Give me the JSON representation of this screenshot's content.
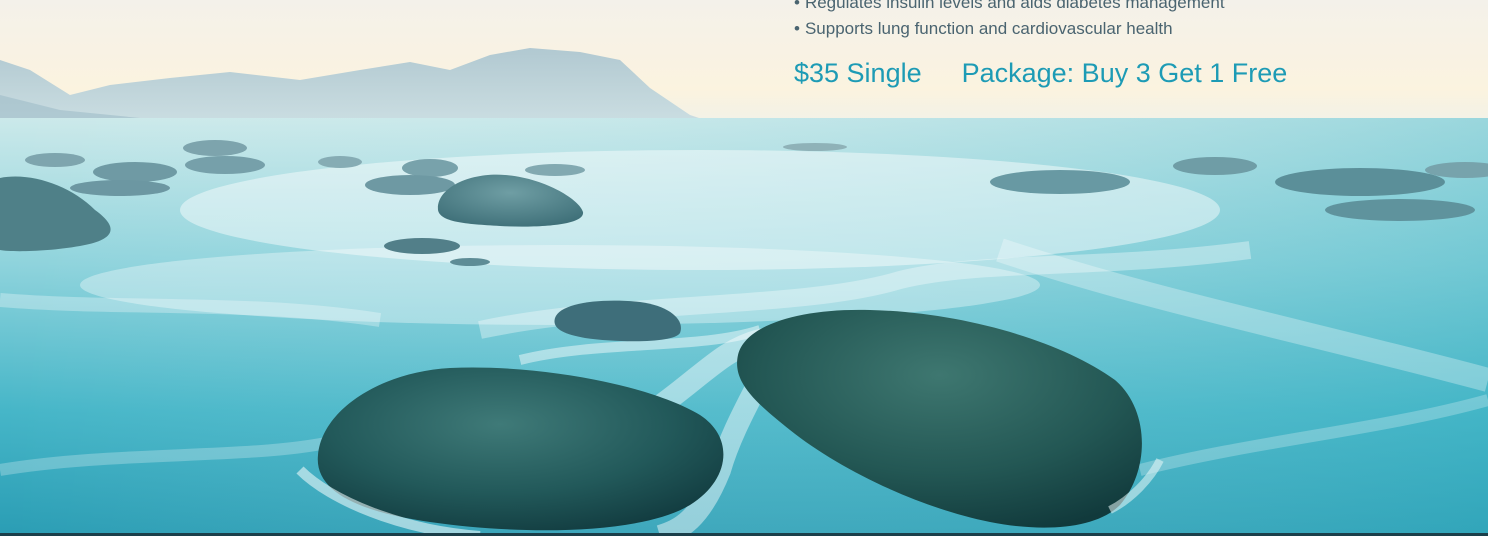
{
  "benefits": [
    "Regulates insulin levels and aids diabetes management",
    "Supports lung function and cardiovascular health"
  ],
  "pricing": {
    "single": "$35 Single",
    "package": "Package: Buy 3 Get 1 Free"
  },
  "colors": {
    "price_text": "#1d9bb5",
    "body_text": "#4a6470",
    "sea": "#3fb6c6",
    "rock": "#1d5254"
  }
}
